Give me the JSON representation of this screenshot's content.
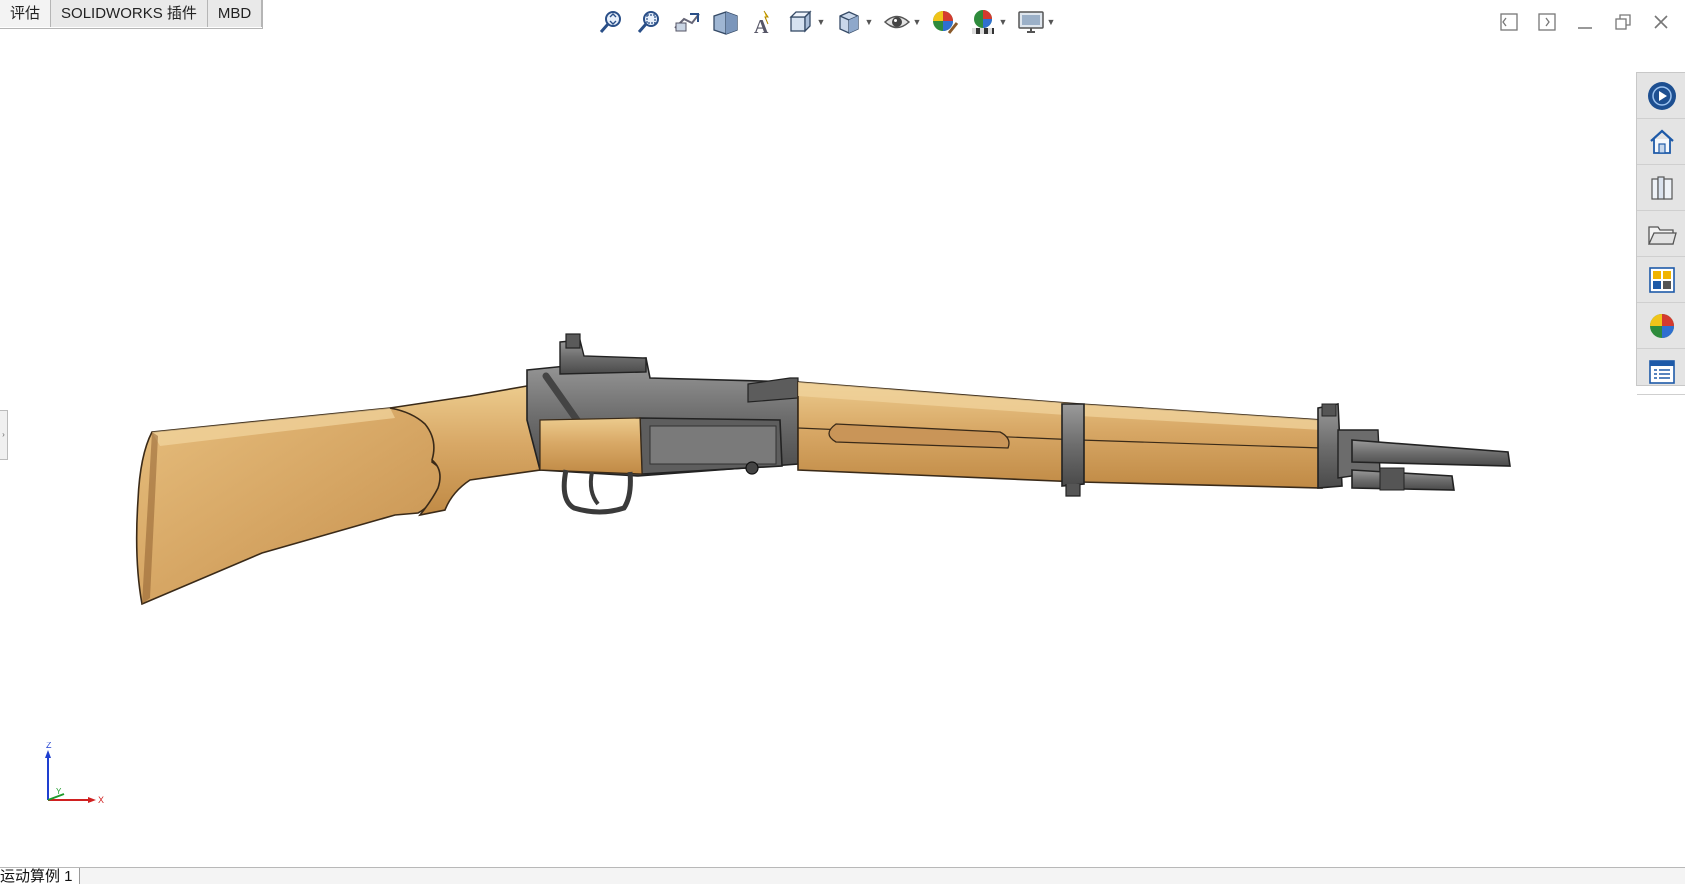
{
  "tabs": [
    {
      "label": "评估"
    },
    {
      "label": "SOLIDWORKS 插件"
    },
    {
      "label": "MBD"
    }
  ],
  "heads_up_toolbar": [
    {
      "icon": "zoom-to-fit-icon"
    },
    {
      "icon": "zoom-to-area-icon"
    },
    {
      "icon": "previous-view-icon"
    },
    {
      "icon": "section-view-icon"
    },
    {
      "icon": "dynamic-annotation-icon"
    },
    {
      "icon": "view-orientation-icon",
      "dropdown": true
    },
    {
      "icon": "display-style-icon",
      "dropdown": true
    },
    {
      "icon": "hide-show-items-icon",
      "dropdown": true
    },
    {
      "icon": "edit-appearance-icon"
    },
    {
      "icon": "apply-scene-icon",
      "dropdown": true
    },
    {
      "icon": "view-settings-icon",
      "dropdown": true
    }
  ],
  "window_controls": [
    "tile-left-icon",
    "tile-right-icon",
    "minimize-icon",
    "restore-icon",
    "close-icon"
  ],
  "task_pane": [
    "solidworks-resources-icon",
    "home-icon",
    "design-library-icon",
    "file-explorer-icon",
    "view-palette-icon",
    "appearances-icon",
    "custom-properties-icon"
  ],
  "triad": {
    "x": "X",
    "y": "Y",
    "z": "Z"
  },
  "bottom_tabs": [
    {
      "label": "运动算例 1"
    }
  ],
  "colors": {
    "wood": "#d8a866",
    "metal": "#6f6f6f",
    "accent_blue": "#1e5aa8"
  }
}
